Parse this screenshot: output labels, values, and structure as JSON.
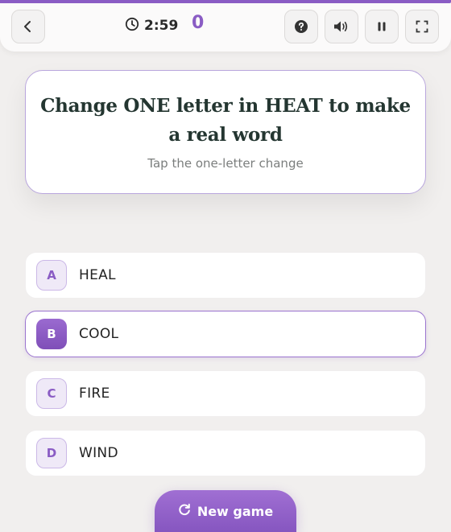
{
  "topbar": {
    "progress": 1.0,
    "timer": "2:59",
    "score": "0",
    "icons": {
      "back": "chevron-left-icon",
      "timer": "clock-icon",
      "help": "help-icon",
      "sound": "volume-icon",
      "pause": "pause-icon",
      "fullscreen": "fullscreen-icon"
    }
  },
  "question": {
    "title": "Change ONE letter in HEAT to make a real word",
    "hint": "Tap the one-letter change"
  },
  "options": [
    {
      "letter": "A",
      "label": "HEAL",
      "selected": false
    },
    {
      "letter": "B",
      "label": "COOL",
      "selected": true
    },
    {
      "letter": "C",
      "label": "FIRE",
      "selected": false
    },
    {
      "letter": "D",
      "label": "WIND",
      "selected": false
    }
  ],
  "new_game": {
    "label": "New game",
    "icon": "refresh-icon"
  },
  "colors": {
    "accent": "#8a5cc4",
    "background": "#f1efee",
    "title": "#243631"
  }
}
